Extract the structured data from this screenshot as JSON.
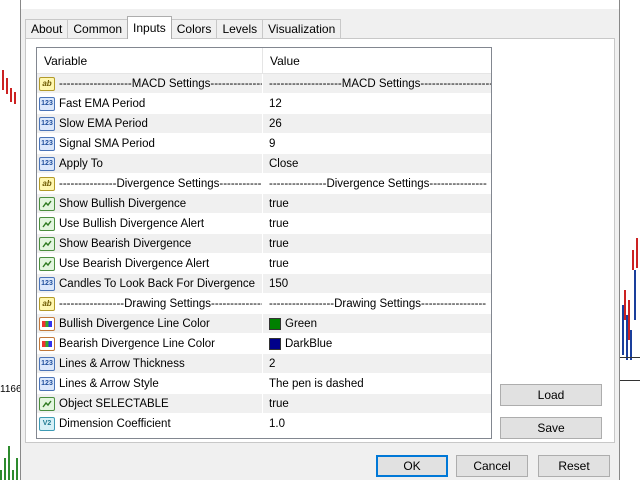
{
  "background": {
    "price_label": "1166",
    "colors": {
      "bear": "#cc2222",
      "bull": "#1a3f9c",
      "volume": "#2e8b2e"
    }
  },
  "dialog": {
    "tabs": [
      {
        "label": "About",
        "active": false
      },
      {
        "label": "Common",
        "active": false
      },
      {
        "label": "Inputs",
        "active": true
      },
      {
        "label": "Colors",
        "active": false
      },
      {
        "label": "Levels",
        "active": false
      },
      {
        "label": "Visualization",
        "active": false
      }
    ],
    "grid": {
      "header_variable": "Variable",
      "header_value": "Value",
      "rows": [
        {
          "icon": "ab",
          "variable": "-------------------MACD Settings-------------------",
          "value": "-------------------MACD Settings-------------------"
        },
        {
          "icon": "123",
          "variable": "Fast EMA Period",
          "value": "12"
        },
        {
          "icon": "123",
          "variable": "Slow EMA Period",
          "value": "26"
        },
        {
          "icon": "123",
          "variable": "Signal SMA Period",
          "value": "9"
        },
        {
          "icon": "123",
          "variable": "Apply To",
          "value": "Close"
        },
        {
          "icon": "ab",
          "variable": "---------------Divergence Settings---------------",
          "value": "---------------Divergence Settings---------------"
        },
        {
          "icon": "bool",
          "variable": "Show Bullish Divergence",
          "value": "true"
        },
        {
          "icon": "bool",
          "variable": "Use Bullish Divergence Alert",
          "value": "true"
        },
        {
          "icon": "bool",
          "variable": "Show Bearish Divergence",
          "value": "true"
        },
        {
          "icon": "bool",
          "variable": "Use Bearish Divergence Alert",
          "value": "true"
        },
        {
          "icon": "123",
          "variable": "Candles To Look Back For Divergence",
          "value": "150"
        },
        {
          "icon": "ab",
          "variable": "-----------------Drawing Settings-----------------",
          "value": "-----------------Drawing Settings-----------------"
        },
        {
          "icon": "color",
          "variable": "Bullish Divergence Line Color",
          "value": "Green",
          "swatch": "#008000"
        },
        {
          "icon": "color",
          "variable": "Bearish Divergence Line Color",
          "value": "DarkBlue",
          "swatch": "#00008b"
        },
        {
          "icon": "123",
          "variable": "Lines & Arrow Thickness",
          "value": "2"
        },
        {
          "icon": "123",
          "variable": "Lines & Arrow Style",
          "value": "The pen is dashed"
        },
        {
          "icon": "bool",
          "variable": "Object SELECTABLE",
          "value": "true"
        },
        {
          "icon": "v2",
          "variable": "Dimension Coefficient",
          "value": "1.0"
        }
      ]
    },
    "buttons": {
      "load": "Load",
      "save": "Save",
      "ok": "OK",
      "cancel": "Cancel",
      "reset": "Reset"
    }
  }
}
